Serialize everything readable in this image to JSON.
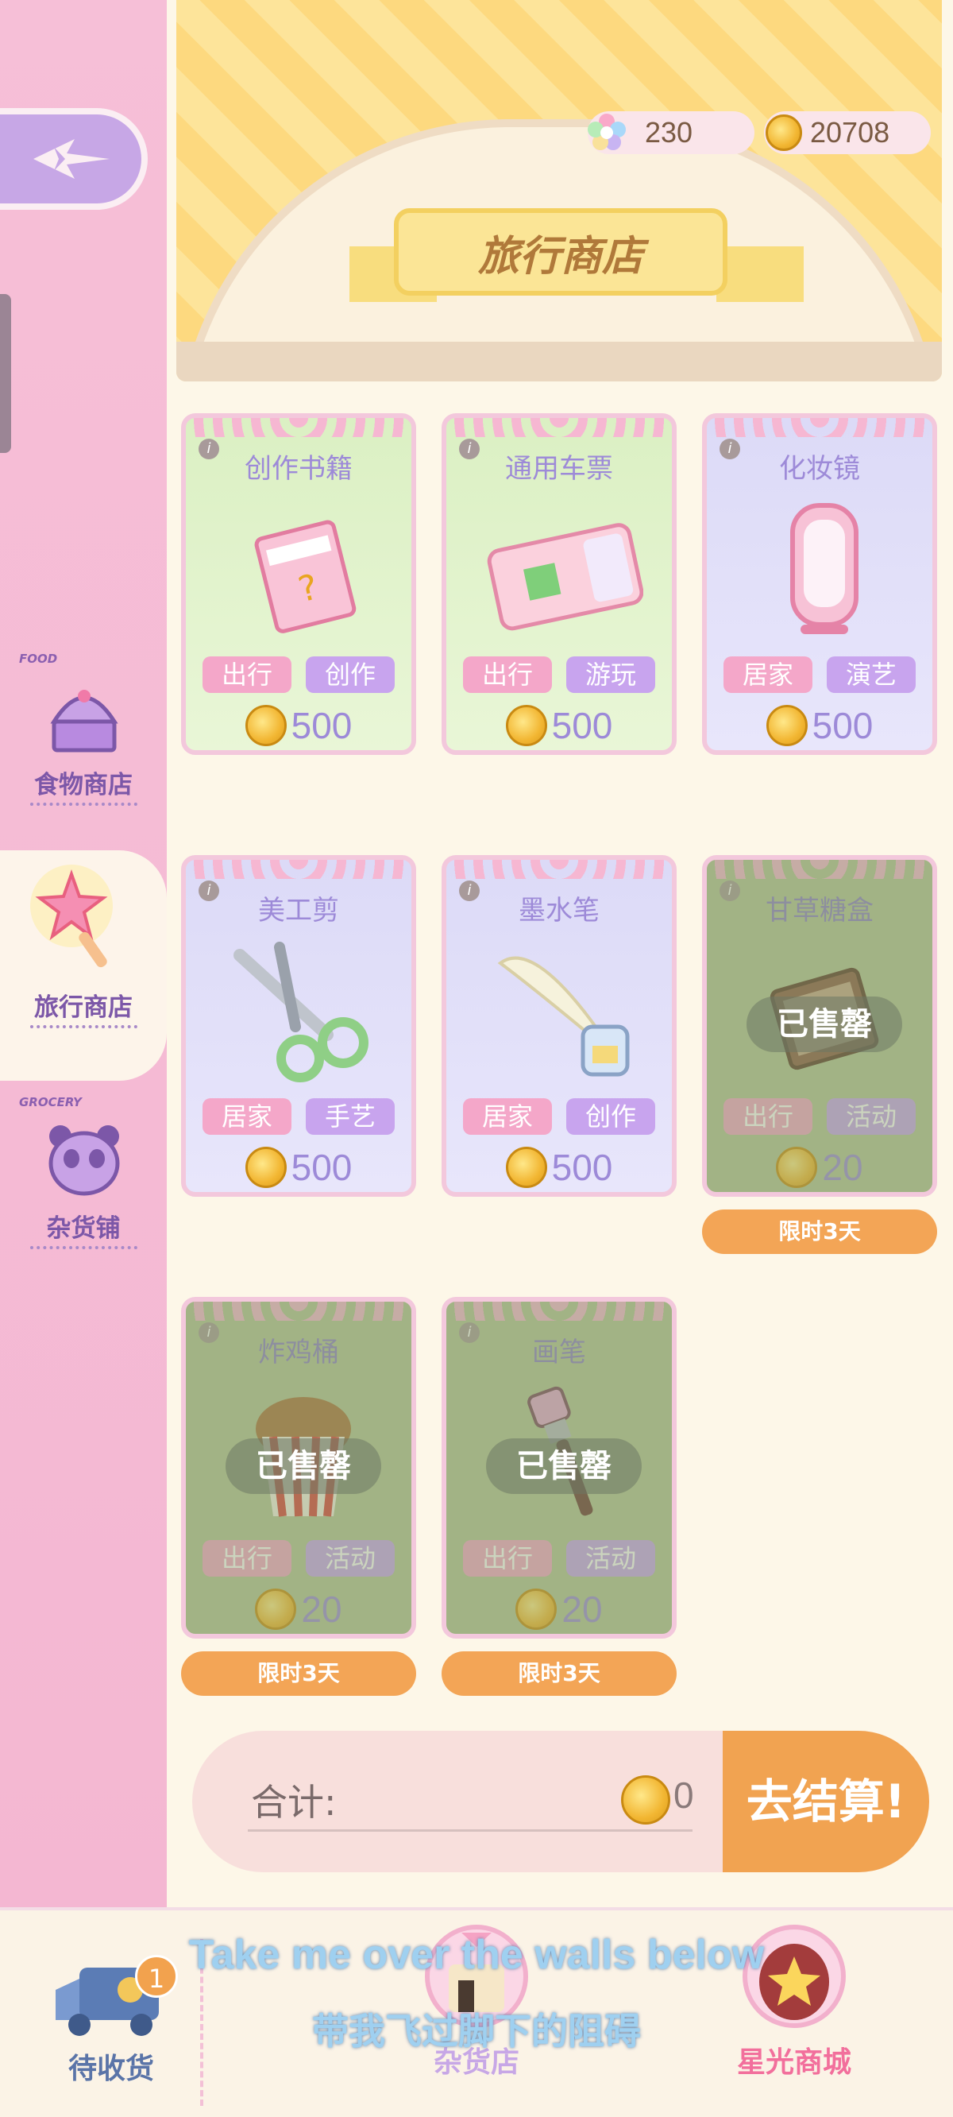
{
  "sidebar": {
    "tabs": [
      {
        "tag": "FOOD",
        "label": "食物商店"
      },
      {
        "tag": "",
        "label": "旅行商店"
      },
      {
        "tag": "GROCERY",
        "label": "杂货铺"
      }
    ]
  },
  "header": {
    "title": "旅行商店",
    "gems": "230",
    "coins": "20708"
  },
  "products": [
    {
      "title": "创作书籍",
      "tags": [
        "出行",
        "创作"
      ],
      "price": "500",
      "sold": false
    },
    {
      "title": "通用车票",
      "tags": [
        "出行",
        "游玩"
      ],
      "price": "500",
      "sold": false
    },
    {
      "title": "化妆镜",
      "tags": [
        "居家",
        "演艺"
      ],
      "price": "500",
      "sold": false
    },
    {
      "title": "美工剪",
      "tags": [
        "居家",
        "手艺"
      ],
      "price": "500",
      "sold": false
    },
    {
      "title": "墨水笔",
      "tags": [
        "居家",
        "创作"
      ],
      "price": "500",
      "sold": false
    },
    {
      "title": "甘草糖盒",
      "tags": [
        "出行",
        "活动"
      ],
      "price": "20",
      "sold": true,
      "sold_label": "已售罄",
      "limit": "限时3天"
    },
    {
      "title": "炸鸡桶",
      "tags": [
        "出行",
        "活动"
      ],
      "price": "20",
      "sold": true,
      "sold_label": "已售罄",
      "limit": "限时3天"
    },
    {
      "title": "画笔",
      "tags": [
        "出行",
        "活动"
      ],
      "price": "20",
      "sold": true,
      "sold_label": "已售罄",
      "limit": "限时3天"
    }
  ],
  "checkout": {
    "total_label": "合计:",
    "total_value": "0",
    "pay_label": "去结算!"
  },
  "bottom_nav": {
    "pending": {
      "label": "待收货",
      "badge": "1"
    },
    "grocery": {
      "label": "杂货店"
    },
    "star_mall": {
      "label": "星光商城"
    }
  },
  "subtitles": {
    "en": "Take me over the walls below",
    "zh": "带我飞过脚下的阻碍"
  }
}
